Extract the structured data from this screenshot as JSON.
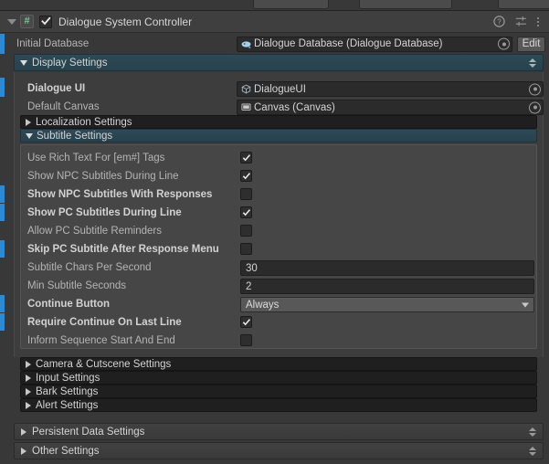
{
  "window": {
    "component_title": "Dialogue System Controller",
    "component_enabled": true,
    "icons": {
      "foldout": "triangle-down-icon",
      "script": "script-icon",
      "enable_checkbox": "checkbox-icon",
      "help": "help-icon",
      "preset": "preset-icon",
      "menu": "kebab-menu-icon"
    }
  },
  "initial_database": {
    "label": "Initial Database",
    "value": "Dialogue Database (Dialogue Database)",
    "edit_label": "Edit",
    "overridden": true
  },
  "display_settings": {
    "label": "Display Settings",
    "expanded": true,
    "fields": [
      {
        "label": "Dialogue UI",
        "value": "DialogueUI",
        "bold": true,
        "icon": "prefab-icon"
      },
      {
        "label": "Default Canvas",
        "value": "Canvas (Canvas)",
        "bold": false,
        "icon": "canvas-icon"
      }
    ],
    "localization_settings": {
      "label": "Localization Settings",
      "expanded": false
    },
    "subtitle_settings": {
      "label": "Subtitle Settings",
      "expanded": true,
      "rows": [
        {
          "label": "Use Rich Text For [em#] Tags",
          "type": "checkbox",
          "value": true,
          "bold": false,
          "overridden": false
        },
        {
          "label": "Show NPC Subtitles During Line",
          "type": "checkbox",
          "value": true,
          "bold": false,
          "overridden": false
        },
        {
          "label": "Show NPC Subtitles With Responses",
          "type": "checkbox",
          "value": false,
          "bold": true,
          "overridden": true
        },
        {
          "label": "Show PC Subtitles During Line",
          "type": "checkbox",
          "value": true,
          "bold": true,
          "overridden": true
        },
        {
          "label": "Allow PC Subtitle Reminders",
          "type": "checkbox",
          "value": false,
          "bold": false,
          "overridden": false
        },
        {
          "label": "Skip PC Subtitle After Response Menu",
          "type": "checkbox",
          "value": false,
          "bold": true,
          "overridden": true
        },
        {
          "label": "Subtitle Chars Per Second",
          "type": "number",
          "value": "30",
          "bold": false,
          "overridden": false
        },
        {
          "label": "Min Subtitle Seconds",
          "type": "number",
          "value": "2",
          "bold": false,
          "overridden": false
        },
        {
          "label": "Continue Button",
          "type": "dropdown",
          "value": "Always",
          "bold": true,
          "overridden": true
        },
        {
          "label": "Require Continue On Last Line",
          "type": "checkbox",
          "value": true,
          "bold": true,
          "overridden": true
        },
        {
          "label": "Inform Sequence Start And End",
          "type": "checkbox",
          "value": false,
          "bold": false,
          "overridden": false
        }
      ]
    },
    "sub_foldouts": [
      {
        "label": "Camera & Cutscene Settings",
        "expanded": false
      },
      {
        "label": "Input Settings",
        "expanded": false
      },
      {
        "label": "Bark Settings",
        "expanded": false
      },
      {
        "label": "Alert Settings",
        "expanded": false
      }
    ]
  },
  "bottom_foldouts": [
    {
      "label": "Persistent Data Settings",
      "expanded": false
    },
    {
      "label": "Other Settings",
      "expanded": false
    }
  ],
  "colors": {
    "background": "#383838",
    "override_bar": "#2a8ad4",
    "section_header": "#2d4a56",
    "script_icon": "#73c990"
  }
}
